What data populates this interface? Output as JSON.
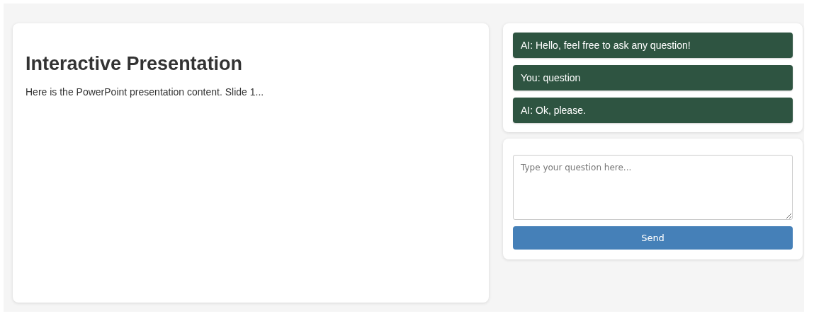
{
  "presentation": {
    "title": "Interactive Presentation",
    "content": "Here is the PowerPoint presentation content. Slide 1..."
  },
  "chat": {
    "messages": [
      {
        "text": "AI: Hello, feel free to ask any question!"
      },
      {
        "text": "You: question"
      },
      {
        "text": "AI: Ok, please."
      }
    ]
  },
  "question": {
    "placeholder": "Type your question here...",
    "send_button": "Send"
  }
}
